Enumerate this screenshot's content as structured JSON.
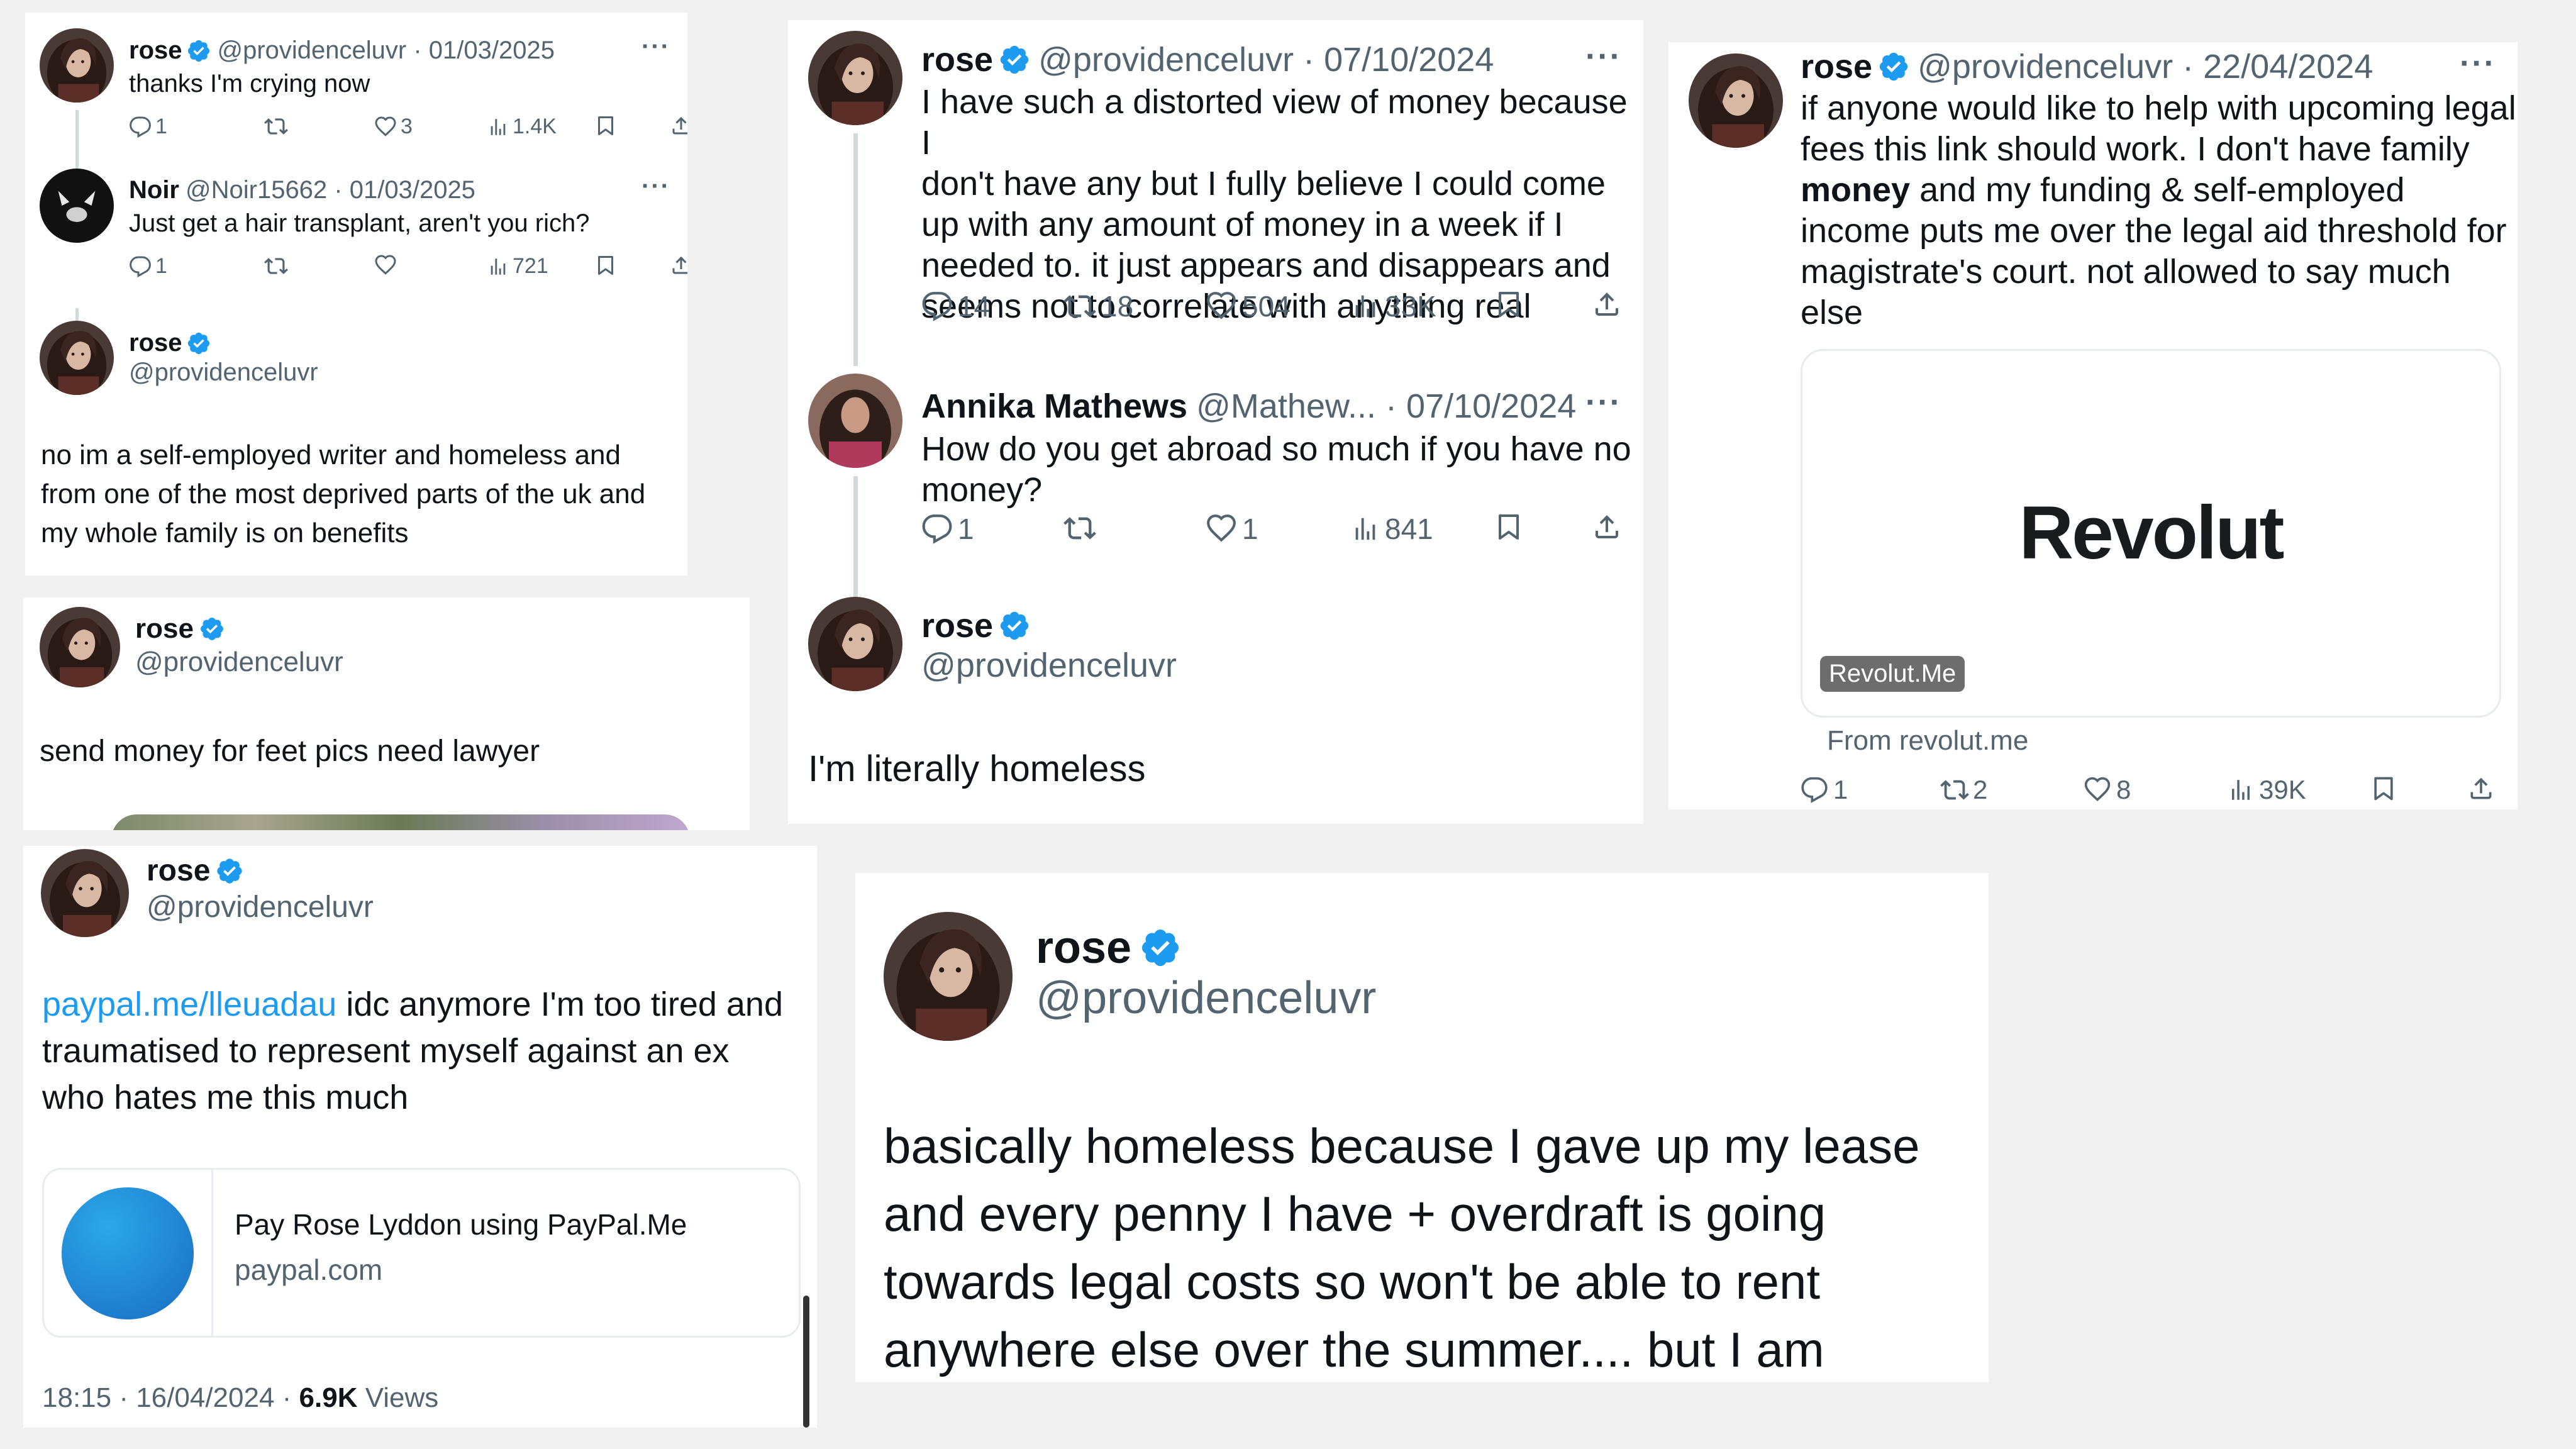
{
  "colors": {
    "verified": "#1d9bf0",
    "muted": "#536471",
    "text": "#0f1419",
    "link": "#1d9bf0",
    "bg": "#f0f0f0"
  },
  "icons": [
    "reply-icon",
    "retweet-icon",
    "like-icon",
    "views-icon",
    "bookmark-icon",
    "share-icon",
    "verified-badge-icon",
    "more-icon"
  ],
  "card1": {
    "t1": {
      "name": "rose",
      "handle": "@providenceluvr",
      "date": "01/03/2025",
      "text": "thanks I'm crying now",
      "replies": "1",
      "retweets": "",
      "likes": "3",
      "views": "1.4K"
    },
    "t2": {
      "name": "Noir",
      "handle": "@Noir15662",
      "date": "01/03/2025",
      "text": "Just get a hair transplant, aren't you rich?",
      "replies": "1",
      "retweets": "",
      "likes": "",
      "views": "721"
    },
    "t3": {
      "name": "rose",
      "handle": "@providenceluvr",
      "lines": [
        "no im a self-employed writer and homeless and",
        "from one of the most deprived parts of the uk and",
        "my whole family is on benefits"
      ]
    }
  },
  "card2": {
    "name": "rose",
    "handle": "@providenceluvr",
    "text": "send money for feet pics need lawyer"
  },
  "card3": {
    "t1": {
      "name": "rose",
      "handle": "@providenceluvr",
      "date": "07/10/2024",
      "lines": [
        "I have such a distorted view of money because I",
        "don't have any but I fully believe I could come",
        "up with any amount of money in a week if I",
        "needed to. it just appears and disappears and",
        "seems not to correlate with anything real"
      ],
      "replies": "14",
      "retweets": "18",
      "likes": "504",
      "views": "33K"
    },
    "t2": {
      "name": "Annika Mathews",
      "handle": "@Mathew...",
      "date": "07/10/2024",
      "lines": [
        "How do you get abroad so much if you have no",
        "money?"
      ],
      "replies": "1",
      "retweets": "",
      "likes": "1",
      "views": "841"
    },
    "t3": {
      "name": "rose",
      "handle": "@providenceluvr",
      "text": "I'm literally homeless"
    }
  },
  "card4": {
    "name": "rose",
    "handle": "@providenceluvr",
    "date": "22/04/2024",
    "line1": "if anyone would like to help with upcoming legal",
    "line2": "fees this link should work. I don't have family",
    "line3_bold": "money",
    "line3_rest": " and my funding & self-employed",
    "line4": "income puts me over the legal aid threshold for",
    "line5": "magistrate's court. not allowed to say much",
    "line6": "else",
    "logo": "Revolut",
    "chip": "Revolut.Me",
    "from": "From revolut.me",
    "replies": "1",
    "retweets": "2",
    "likes": "8",
    "views": "39K"
  },
  "card5": {
    "name": "rose",
    "handle": "@providenceluvr",
    "link": "paypal.me/lleuadau",
    "line1_rest": " idc anymore I'm too tired and",
    "line2": "traumatised to represent myself against an ex",
    "line3": "who hates me this much",
    "preview_title": "Pay Rose Lyddon using PayPal.Me",
    "preview_domain": "paypal.com",
    "time": "18:15 · 16/04/2024 · ",
    "views_count": "6.9K",
    "views_label": " Views"
  },
  "card6": {
    "name": "rose",
    "handle": "@providenceluvr",
    "lines": [
      "basically homeless because I gave up my lease",
      "and every penny I have + overdraft is going",
      "towards legal costs so won't be able to rent",
      "anywhere else over the summer.... but I am"
    ]
  }
}
